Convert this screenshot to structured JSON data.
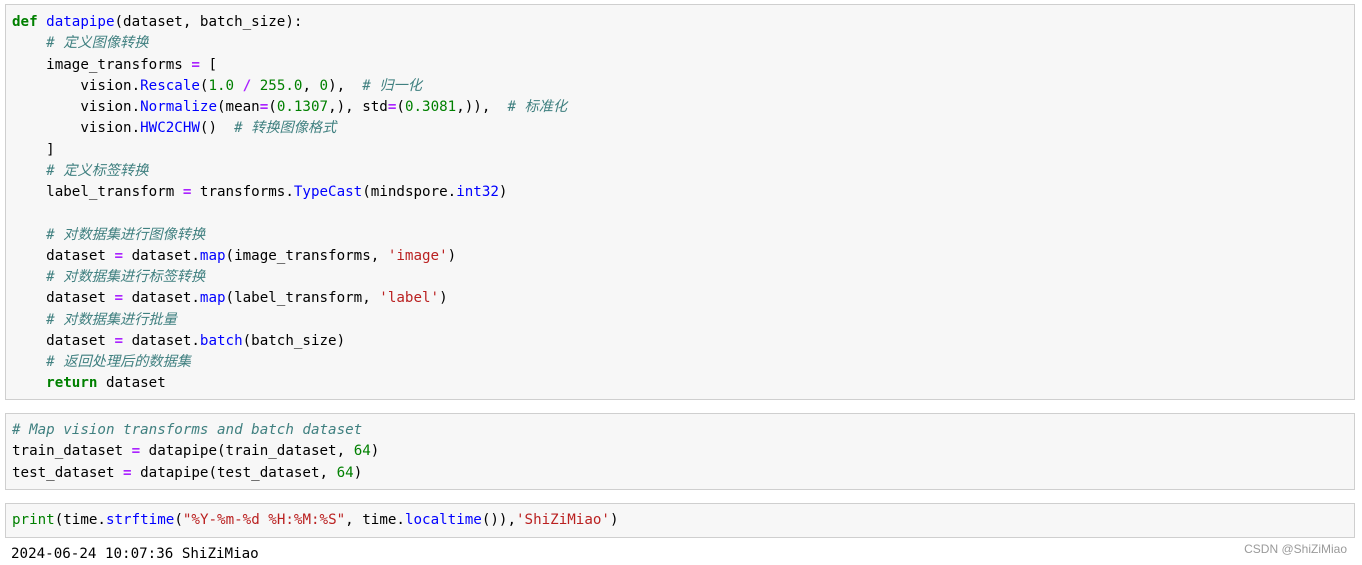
{
  "cells": [
    {
      "lines": [
        [
          [
            "kw",
            "def"
          ],
          [
            "p",
            " "
          ],
          [
            "fn",
            "datapipe"
          ],
          [
            "p",
            "(dataset, batch_size):"
          ]
        ],
        [
          [
            "p",
            "    "
          ],
          [
            "cm",
            "# 定义图像转换"
          ]
        ],
        [
          [
            "p",
            "    image_transforms "
          ],
          [
            "op",
            "="
          ],
          [
            "p",
            " ["
          ]
        ],
        [
          [
            "p",
            "        vision."
          ],
          [
            "at",
            "Rescale"
          ],
          [
            "p",
            "("
          ],
          [
            "num",
            "1.0"
          ],
          [
            "p",
            " "
          ],
          [
            "op",
            "/"
          ],
          [
            "p",
            " "
          ],
          [
            "num",
            "255.0"
          ],
          [
            "p",
            ", "
          ],
          [
            "num",
            "0"
          ],
          [
            "p",
            "),  "
          ],
          [
            "cm",
            "# 归一化"
          ]
        ],
        [
          [
            "p",
            "        vision."
          ],
          [
            "at",
            "Normalize"
          ],
          [
            "p",
            "(mean"
          ],
          [
            "op",
            "="
          ],
          [
            "p",
            "("
          ],
          [
            "num",
            "0.1307"
          ],
          [
            "p",
            ",), std"
          ],
          [
            "op",
            "="
          ],
          [
            "p",
            "("
          ],
          [
            "num",
            "0.3081"
          ],
          [
            "p",
            ",)),  "
          ],
          [
            "cm",
            "# 标准化"
          ]
        ],
        [
          [
            "p",
            "        vision."
          ],
          [
            "at",
            "HWC2CHW"
          ],
          [
            "p",
            "()  "
          ],
          [
            "cm",
            "# 转换图像格式"
          ]
        ],
        [
          [
            "p",
            "    ]"
          ]
        ],
        [
          [
            "p",
            "    "
          ],
          [
            "cm",
            "# 定义标签转换"
          ]
        ],
        [
          [
            "p",
            "    label_transform "
          ],
          [
            "op",
            "="
          ],
          [
            "p",
            " transforms."
          ],
          [
            "at",
            "TypeCast"
          ],
          [
            "p",
            "(mindspore."
          ],
          [
            "at",
            "int32"
          ],
          [
            "p",
            ")"
          ]
        ],
        [
          [
            "p",
            ""
          ]
        ],
        [
          [
            "p",
            "    "
          ],
          [
            "cm",
            "# 对数据集进行图像转换"
          ]
        ],
        [
          [
            "p",
            "    dataset "
          ],
          [
            "op",
            "="
          ],
          [
            "p",
            " dataset."
          ],
          [
            "at",
            "map"
          ],
          [
            "p",
            "(image_transforms, "
          ],
          [
            "str",
            "'image'"
          ],
          [
            "p",
            ")"
          ]
        ],
        [
          [
            "p",
            "    "
          ],
          [
            "cm",
            "# 对数据集进行标签转换"
          ]
        ],
        [
          [
            "p",
            "    dataset "
          ],
          [
            "op",
            "="
          ],
          [
            "p",
            " dataset."
          ],
          [
            "at",
            "map"
          ],
          [
            "p",
            "(label_transform, "
          ],
          [
            "str",
            "'label'"
          ],
          [
            "p",
            ")"
          ]
        ],
        [
          [
            "p",
            "    "
          ],
          [
            "cm",
            "# 对数据集进行批量"
          ]
        ],
        [
          [
            "p",
            "    dataset "
          ],
          [
            "op",
            "="
          ],
          [
            "p",
            " dataset."
          ],
          [
            "at",
            "batch"
          ],
          [
            "p",
            "(batch_size)"
          ]
        ],
        [
          [
            "p",
            "    "
          ],
          [
            "cm",
            "# 返回处理后的数据集"
          ]
        ],
        [
          [
            "p",
            "    "
          ],
          [
            "kw",
            "return"
          ],
          [
            "p",
            " dataset"
          ]
        ]
      ]
    },
    {
      "lines": [
        [
          [
            "cm",
            "# Map vision transforms and batch dataset"
          ]
        ],
        [
          [
            "p",
            "train_dataset "
          ],
          [
            "op",
            "="
          ],
          [
            "p",
            " datapipe(train_dataset, "
          ],
          [
            "num",
            "64"
          ],
          [
            "p",
            ")"
          ]
        ],
        [
          [
            "p",
            "test_dataset "
          ],
          [
            "op",
            "="
          ],
          [
            "p",
            " datapipe(test_dataset, "
          ],
          [
            "num",
            "64"
          ],
          [
            "p",
            ")"
          ]
        ]
      ]
    },
    {
      "lines": [
        [
          [
            "bi",
            "print"
          ],
          [
            "p",
            "(time."
          ],
          [
            "at",
            "strftime"
          ],
          [
            "p",
            "("
          ],
          [
            "str",
            "\"%Y-%m-%d %H:%M:%S\""
          ],
          [
            "p",
            ", time."
          ],
          [
            "at",
            "localtime"
          ],
          [
            "p",
            "()),"
          ],
          [
            "str",
            "'ShiZiMiao'"
          ],
          [
            "p",
            ")"
          ]
        ]
      ]
    }
  ],
  "output": "2024-06-24 10:07:36 ShiZiMiao",
  "watermark": "CSDN @ShiZiMiao",
  "colors": {
    "keyword": "#008000",
    "function_name": "#0000ff",
    "comment": "#408080",
    "number": "#008000",
    "string": "#ba2121",
    "operator": "#aa22ff",
    "cell_background": "#f7f7f7",
    "cell_border": "#cfcfcf"
  }
}
